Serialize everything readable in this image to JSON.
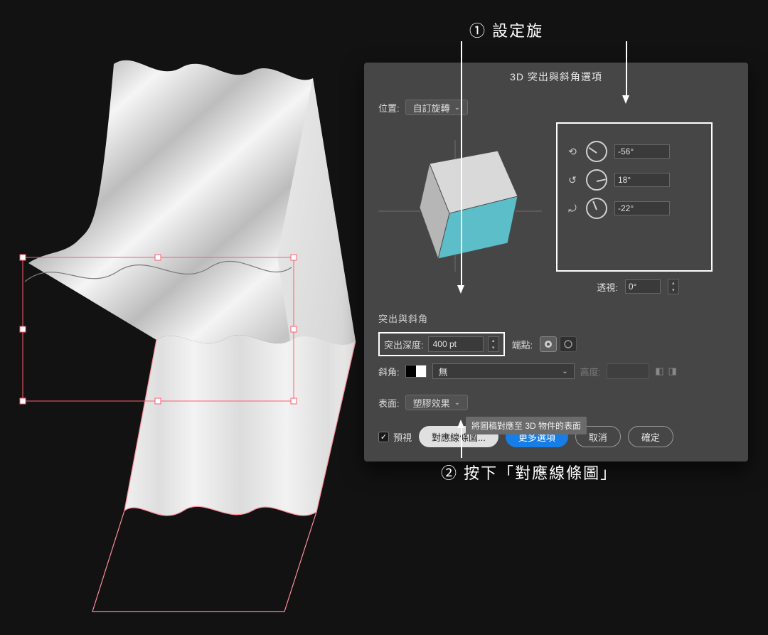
{
  "annotations": {
    "step1": "① 設定旋",
    "step2": "② 按下「對應線條圖」"
  },
  "dialog": {
    "title": "3D 突出與斜角選項",
    "position_label": "位置:",
    "position_value": "自訂旋轉",
    "rotation": {
      "x": "-56°",
      "y": "18°",
      "z": "-22°"
    },
    "perspective_label": "透視:",
    "perspective_value": "0°",
    "section_extrude": "突出與斜角",
    "depth_label": "突出深度:",
    "depth_value": "400 pt",
    "cap_label": "端點:",
    "bevel_label": "斜角:",
    "bevel_value": "無",
    "height_label": "高度:",
    "surface_label": "表面:",
    "surface_value": "塑膠效果",
    "preview_label": "預視",
    "map_art": "對應線條圖...",
    "more_options": "更多選項",
    "cancel": "取消",
    "ok": "確定",
    "tooltip": "將圖稿對應至 3D 物件的表面"
  }
}
